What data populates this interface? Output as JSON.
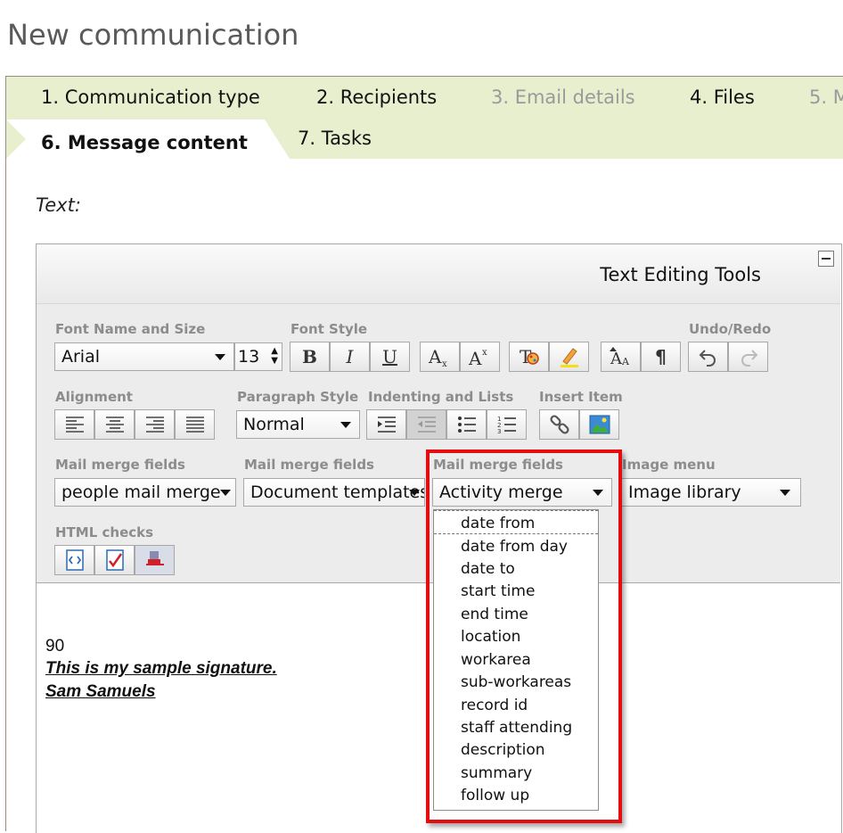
{
  "page": {
    "title": "New communication"
  },
  "wizard": {
    "tabs": [
      {
        "label": "1. Communication type",
        "state": "enabled"
      },
      {
        "label": "2. Recipients",
        "state": "enabled"
      },
      {
        "label": "3. Email details",
        "state": "disabled"
      },
      {
        "label": "4. Files",
        "state": "enabled"
      },
      {
        "label": "5. M",
        "state": "disabled"
      },
      {
        "label": "6. Message content",
        "state": "active"
      },
      {
        "label": "7. Tasks",
        "state": "enabled"
      }
    ]
  },
  "form": {
    "text_label": "Text:"
  },
  "editor": {
    "header_title": "Text Editing Tools",
    "groups": {
      "font": "Font Name and Size",
      "font_style": "Font Style",
      "undo_redo": "Undo/Redo",
      "alignment": "Alignment",
      "paragraph": "Paragraph Style",
      "indent_lists": "Indenting and Lists",
      "insert_item": "Insert Item",
      "mail_merge_1": "Mail merge fields",
      "mail_merge_2": "Mail merge fields",
      "mail_merge_3": "Mail merge fields",
      "image_menu": "Image menu",
      "html_checks": "HTML checks"
    },
    "font_name": "Arial",
    "font_size": "13",
    "paragraph_style": "Normal",
    "mail_merge_1": "people mail merge",
    "mail_merge_2": "Document templates",
    "mail_merge_3": "Activity merge",
    "image_menu": "Image library",
    "icons": {
      "bold": "B",
      "italic": "I",
      "underline": "U",
      "pilcrow": "¶"
    }
  },
  "dropdown": {
    "items": [
      "date from",
      "date from day",
      "date to",
      "start time",
      "end time",
      "location",
      "workarea",
      "sub-workareas",
      "record id",
      "staff attending",
      "description",
      "summary",
      "follow up"
    ]
  },
  "content": {
    "line1": "90",
    "signature_line1": "This is my sample signature.",
    "signature_line2": "Sam Samuels"
  },
  "colors": {
    "tab_bar": "#e7efcf",
    "highlight": "#e50b10"
  }
}
